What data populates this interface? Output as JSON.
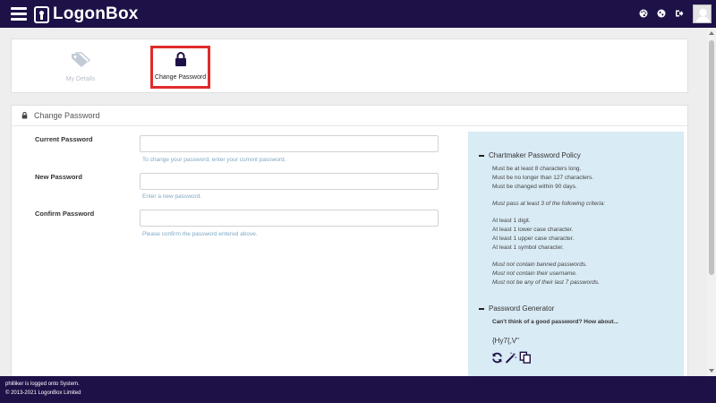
{
  "app": {
    "brand": "LogonBox",
    "colors": {
      "navbar": "#1e1147",
      "accent": "#e02b2b",
      "policy_bg": "#d9ebf5",
      "help_text": "#7fa8c4"
    }
  },
  "navbar": {
    "icons": [
      "palette-icon",
      "globe-icon",
      "sign-out-icon"
    ],
    "avatar": "user-avatar"
  },
  "tabs": [
    {
      "label": "My Details",
      "icon": "tag-icon",
      "active": false
    },
    {
      "label": "Change Password",
      "icon": "lock-icon",
      "active": true
    }
  ],
  "panel": {
    "title": "Change Password",
    "fields": [
      {
        "label": "Current Password",
        "value": "",
        "help": "To change your password, enter your current password."
      },
      {
        "label": "New Password",
        "value": "",
        "help": "Enter a new password."
      },
      {
        "label": "Confirm Password",
        "value": "",
        "help": "Please confirm the password entered above."
      }
    ]
  },
  "policy": {
    "heading": "Chartmaker Password Policy",
    "rules": [
      "Must be at least 8 characters long.",
      "Must be no longer than 127 characters.",
      "Must be changed within 90 days."
    ],
    "criteria_intro": "Must pass at least 3 of the following criteria:",
    "criteria": [
      "At least 1 digit.",
      "At least 1 lower case character.",
      "At least 1 upper case character.",
      "At least 1 symbol character."
    ],
    "restrictions": [
      "Must not contain banned passwords.",
      "Must not contain their username.",
      "Must not be any of their last 7 passwords."
    ]
  },
  "generator": {
    "heading": "Password Generator",
    "prompt": "Can't think of a good password? How about...",
    "suggestion": "{Hy7{,V\"",
    "tools": [
      "refresh-icon",
      "magic-wand-icon",
      "copy-icon"
    ]
  },
  "footer": {
    "login_status": "philliker is logged onto System.",
    "copyright": "© 2013-2021 LogonBox Limited"
  }
}
